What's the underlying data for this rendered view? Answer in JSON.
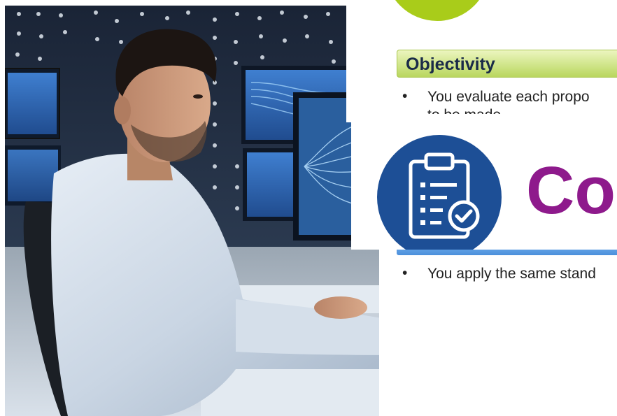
{
  "photo": {
    "subject": "man-at-monitoring-workstation"
  },
  "slide_objectivity": {
    "header": "Objectivity",
    "bullet_symbol": "•",
    "bullet_text": "You evaluate each propo",
    "bullet_text_cut": "to be made"
  },
  "slide_title": {
    "title": "Co",
    "icon": "clipboard-check-icon"
  },
  "slide_consistency": {
    "bullet_symbol": "•",
    "bullet_text": "You apply the same stand"
  },
  "colors": {
    "green_accent": "#a9cc1a",
    "navy_circle": "#1d4f96",
    "title_purple": "#8e1a8c",
    "header_text": "#1a2b48",
    "blue_strip": "#4b8fdc"
  }
}
